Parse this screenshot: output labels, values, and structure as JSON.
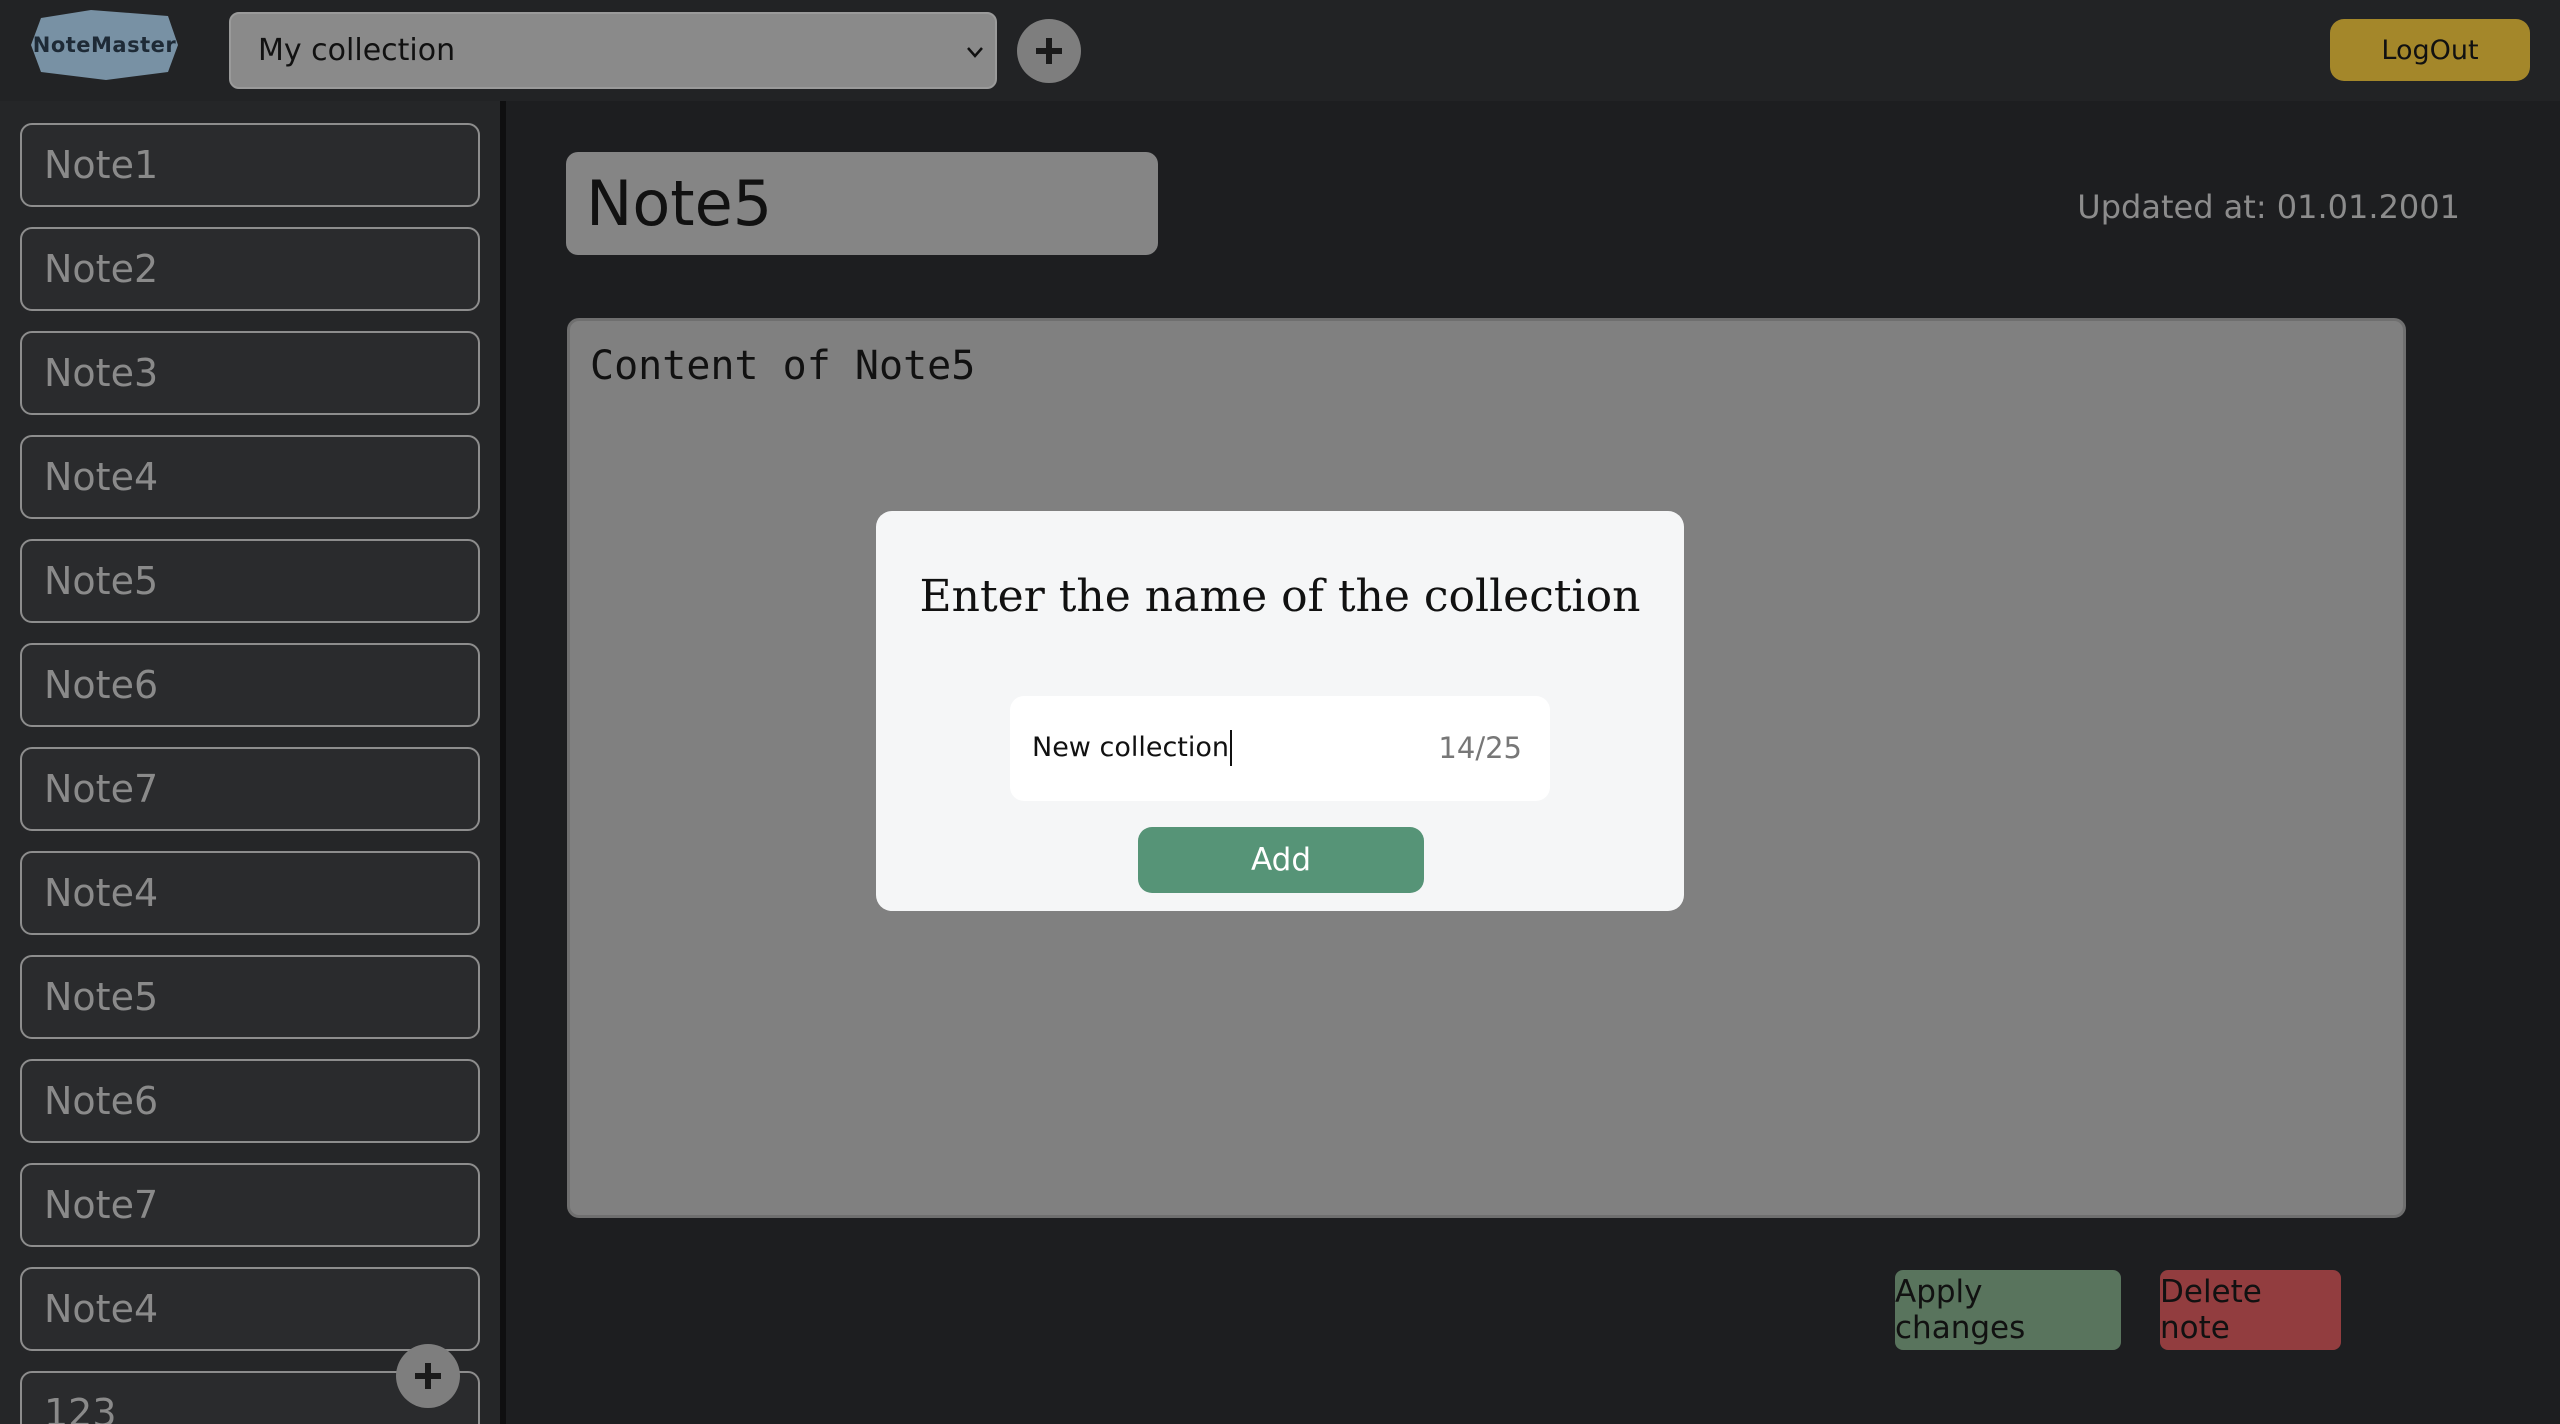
{
  "app": {
    "logo_text": "NoteMaster"
  },
  "header": {
    "collection_selected": "My collection",
    "logout_label": "LogOut"
  },
  "sidebar": {
    "notes": [
      "Note1",
      "Note2",
      "Note3",
      "Note4",
      "Note5",
      "Note6",
      "Note7",
      "Note4",
      "Note5",
      "Note6",
      "Note7",
      "Note4",
      "123"
    ]
  },
  "editor": {
    "title": "Note5",
    "updated_at": "Updated at: 01.01.2001",
    "content": "Content of Note5",
    "apply_label": "Apply changes",
    "delete_label": "Delete note"
  },
  "modal": {
    "title": "Enter the name of the collection",
    "input_value": "New collection",
    "counter": "14/25",
    "add_label": "Add"
  },
  "colors": {
    "logout": "#a4872a",
    "apply": "#59745d",
    "delete": "#923d3f",
    "modal_add": "#569477"
  }
}
